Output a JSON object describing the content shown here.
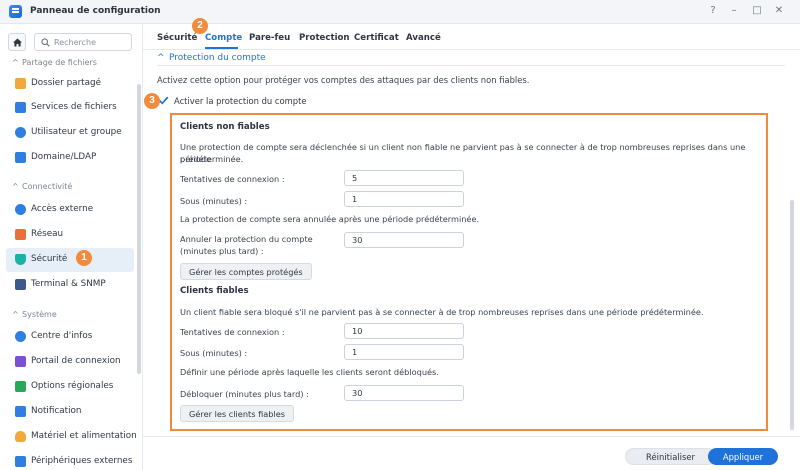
{
  "window": {
    "title": "Panneau de configuration",
    "help": "?",
    "minimize": "–",
    "maximize": "□",
    "close": "✕"
  },
  "sidebar": {
    "search_placeholder": "Recherche",
    "sections": [
      {
        "label": "Partage de fichiers",
        "items": [
          {
            "label": "Dossier partagé",
            "icon": "folder-icon",
            "color": "#f2a93b"
          },
          {
            "label": "Services de fichiers",
            "icon": "file-services-icon",
            "color": "#2f7fe0"
          },
          {
            "label": "Utilisateur et groupe",
            "icon": "users-icon",
            "color": "#2f7fe0"
          },
          {
            "label": "Domaine/LDAP",
            "icon": "domain-icon",
            "color": "#2f7fe0"
          }
        ]
      },
      {
        "label": "Connectivité",
        "items": [
          {
            "label": "Accès externe",
            "icon": "external-access-icon",
            "color": "#2f7fe0"
          },
          {
            "label": "Réseau",
            "icon": "network-icon",
            "color": "#e8703a"
          },
          {
            "label": "Sécurité",
            "icon": "shield-icon",
            "color": "#19b3a6",
            "active": true
          },
          {
            "label": "Terminal & SNMP",
            "icon": "terminal-icon",
            "color": "#3c5b8c"
          }
        ]
      },
      {
        "label": "Système",
        "items": [
          {
            "label": "Centre d'infos",
            "icon": "info-icon",
            "color": "#2f7fe0"
          },
          {
            "label": "Portail de connexion",
            "icon": "portal-icon",
            "color": "#7b4fd6"
          },
          {
            "label": "Options régionales",
            "icon": "regional-icon",
            "color": "#2aa85a"
          },
          {
            "label": "Notification",
            "icon": "notification-icon",
            "color": "#2f7fe0"
          },
          {
            "label": "Matériel et alimentation",
            "icon": "power-icon",
            "color": "#f2a93b"
          },
          {
            "label": "Périphériques externes",
            "icon": "devices-icon",
            "color": "#2f7fe0"
          }
        ]
      }
    ]
  },
  "tabs": [
    {
      "label": "Sécurité"
    },
    {
      "label": "Compte",
      "active": true
    },
    {
      "label": "Pare-feu"
    },
    {
      "label": "Protection"
    },
    {
      "label": "Certificat"
    },
    {
      "label": "Avancé"
    }
  ],
  "badges": {
    "b1": "1",
    "b2": "2",
    "b3": "3"
  },
  "section": {
    "title": "Protection du compte",
    "description": "Activez cette option pour protéger vos comptes des attaques par des clients non fiables.",
    "checkbox_label": "Activer la protection du compte",
    "checkbox_checked": true
  },
  "untrusted": {
    "title": "Clients non fiables",
    "text1": "Une protection de compte sera déclenchée si un client non fiable ne parvient pas à se connecter à de trop nombreuses reprises dans une période",
    "text1b": "prédéterminée.",
    "attempts_label": "Tentatives de connexion :",
    "attempts_value": "5",
    "minutes_label": "Sous (minutes) :",
    "minutes_value": "1",
    "text2": "La protection de compte sera annulée après une période prédéterminée.",
    "cancel_label_1": "Annuler la protection du compte",
    "cancel_label_2": "(minutes plus tard) :",
    "cancel_value": "30",
    "manage_button": "Gérer les comptes protégés"
  },
  "trusted": {
    "title": "Clients fiables",
    "text1": "Un client fiable sera bloqué s'il ne parvient pas à se connecter à de trop nombreuses reprises dans une période prédéterminée.",
    "attempts_label": "Tentatives de connexion :",
    "attempts_value": "10",
    "minutes_label": "Sous (minutes) :",
    "minutes_value": "1",
    "text2": "Définir une période après laquelle les clients seront débloqués.",
    "unblock_label": "Débloquer (minutes plus tard) :",
    "unblock_value": "30",
    "manage_button": "Gérer les clients fiables"
  },
  "footer": {
    "reset": "Réinitialiser",
    "apply": "Appliquer"
  },
  "colors": {
    "accent": "#1f73d8",
    "highlight": "#f08a3c"
  }
}
